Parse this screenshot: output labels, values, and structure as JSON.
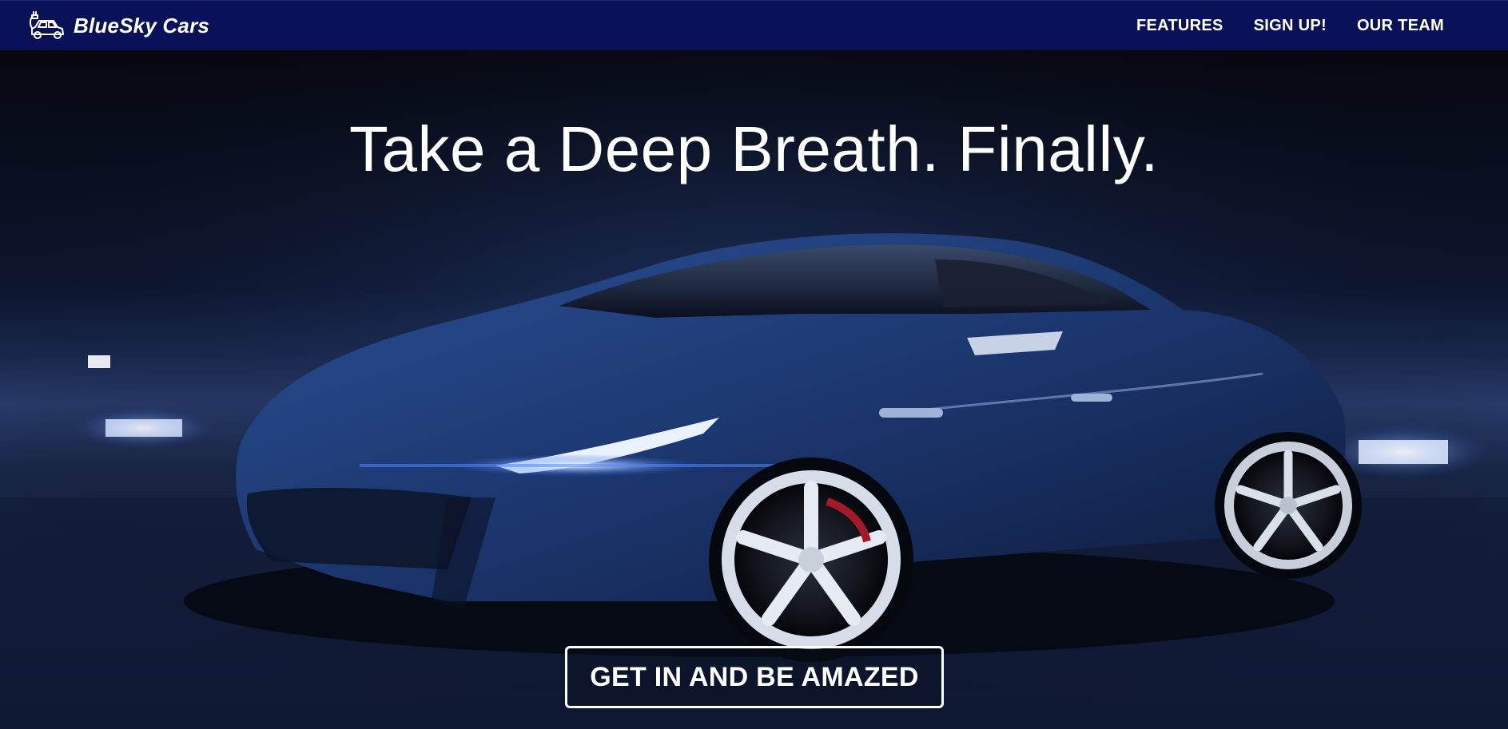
{
  "navbar": {
    "brand_name": "BlueSky Cars",
    "brand_icon": "electric-car-icon",
    "background": "#0a1158",
    "links": [
      {
        "label": "FEATURES"
      },
      {
        "label": "SIGN UP!"
      },
      {
        "label": "OUR TEAM"
      }
    ]
  },
  "hero": {
    "headline": "Take a Deep Breath. Finally.",
    "background_image": "blue electric sports car at night",
    "cta_label": "GET IN AND BE AMAZED"
  },
  "colors": {
    "nav_bg": "#0a1158",
    "text": "#ffffff",
    "car_blue": "#1d3a7a",
    "backdrop": "#0b1224"
  }
}
